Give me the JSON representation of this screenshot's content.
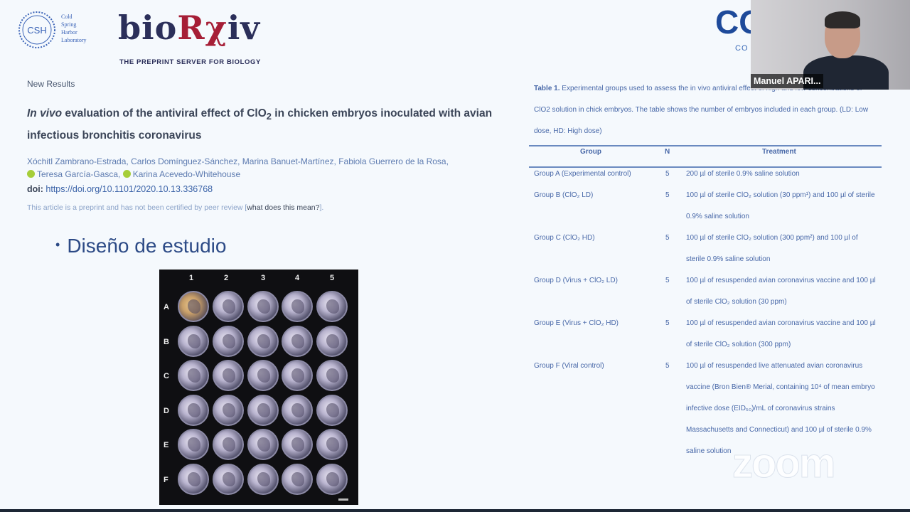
{
  "header": {
    "csh_lines": [
      "Cold",
      "Spring",
      "Harbor",
      "Laboratory"
    ],
    "csh_badge": "CSH",
    "biorxiv_part1": "bio",
    "biorxiv_part2": "R",
    "biorxiv_part3": "χ",
    "biorxiv_part4": "iv",
    "biorxiv_tagline": "THE PREPRINT SERVER FOR BIOLOGY"
  },
  "article": {
    "section": "New Results",
    "title_italic": "In vivo",
    "title_part1": " evaluation of the antiviral effect of ClO",
    "title_sub": "2",
    "title_part2": " in chicken embryos inoculated with avian infectious bronchitis coronavirus",
    "authors_line1": "Xóchitl Zambrano-Estrada, Carlos Domínguez-Sánchez, Marina Banuet-Martínez, Fabiola Guerrero de la Rosa,",
    "author_a": "Teresa García-Gasca,",
    "author_b": "Karina Acevedo-Whitehouse",
    "doi_label": "doi:",
    "doi_url": "https://doi.org/10.1101/2020.10.13.336768",
    "preprint_note": "This article is a preprint and has not been certified by peer review [",
    "preprint_link": "what does this mean?",
    "preprint_close": "]."
  },
  "slide": {
    "bullet": "Diseño de estudio"
  },
  "plate": {
    "columns": [
      "1",
      "2",
      "3",
      "4",
      "5"
    ],
    "rows": [
      "A",
      "B",
      "C",
      "D",
      "E",
      "F"
    ]
  },
  "table": {
    "caption_label": "Table 1.",
    "caption_text": " Experimental groups used to assess the in vivo antiviral effect of high and low concentrations of ClO2 solution in chick embryos. The table shows the number of embryos included in each group. (LD: Low dose, HD: High dose)",
    "headers": [
      "Group",
      "N",
      "Treatment"
    ],
    "rows": [
      {
        "group": "Group A (Experimental control)",
        "n": "5",
        "treatment": "200 µl of sterile 0.9% saline solution"
      },
      {
        "group": "Group B (ClO₂ LD)",
        "n": "5",
        "treatment": "100 µl of sterile ClO₂ solution (30 ppm¹) and 100 µl of sterile 0.9% saline solution"
      },
      {
        "group": "Group C (ClO₂ HD)",
        "n": "5",
        "treatment": "100 µl of sterile ClO₂ solution (300 ppm²) and 100 µl of sterile 0.9% saline solution"
      },
      {
        "group": "Group D (Virus + ClO₂ LD)",
        "n": "5",
        "treatment": "100 µl of resuspended avian coronavirus vaccine and 100 µl of sterile ClO₂ solution (30 ppm)"
      },
      {
        "group": "Group E (Virus + ClO₂ HD)",
        "n": "5",
        "treatment": "100 µl of resuspended avian coronavirus vaccine and 100 µl of sterile ClO₂ solution (300 ppm)"
      },
      {
        "group": "Group F (Viral control)",
        "n": "5",
        "treatment": "100 µl of resuspended live attenuated avian coronavirus vaccine (Bron Bien® Merial, containing 10⁴ of mean embryo infective dose (EID₅₀)/mL of coronavirus strains Massachusetts and Connecticut) and 100 µl of sterile 0.9% saline solution"
      }
    ]
  },
  "partial_logo": {
    "text": "CO",
    "sub": "CO"
  },
  "video": {
    "participant_name": "Manuel APARI..."
  },
  "watermark": "zoom"
}
